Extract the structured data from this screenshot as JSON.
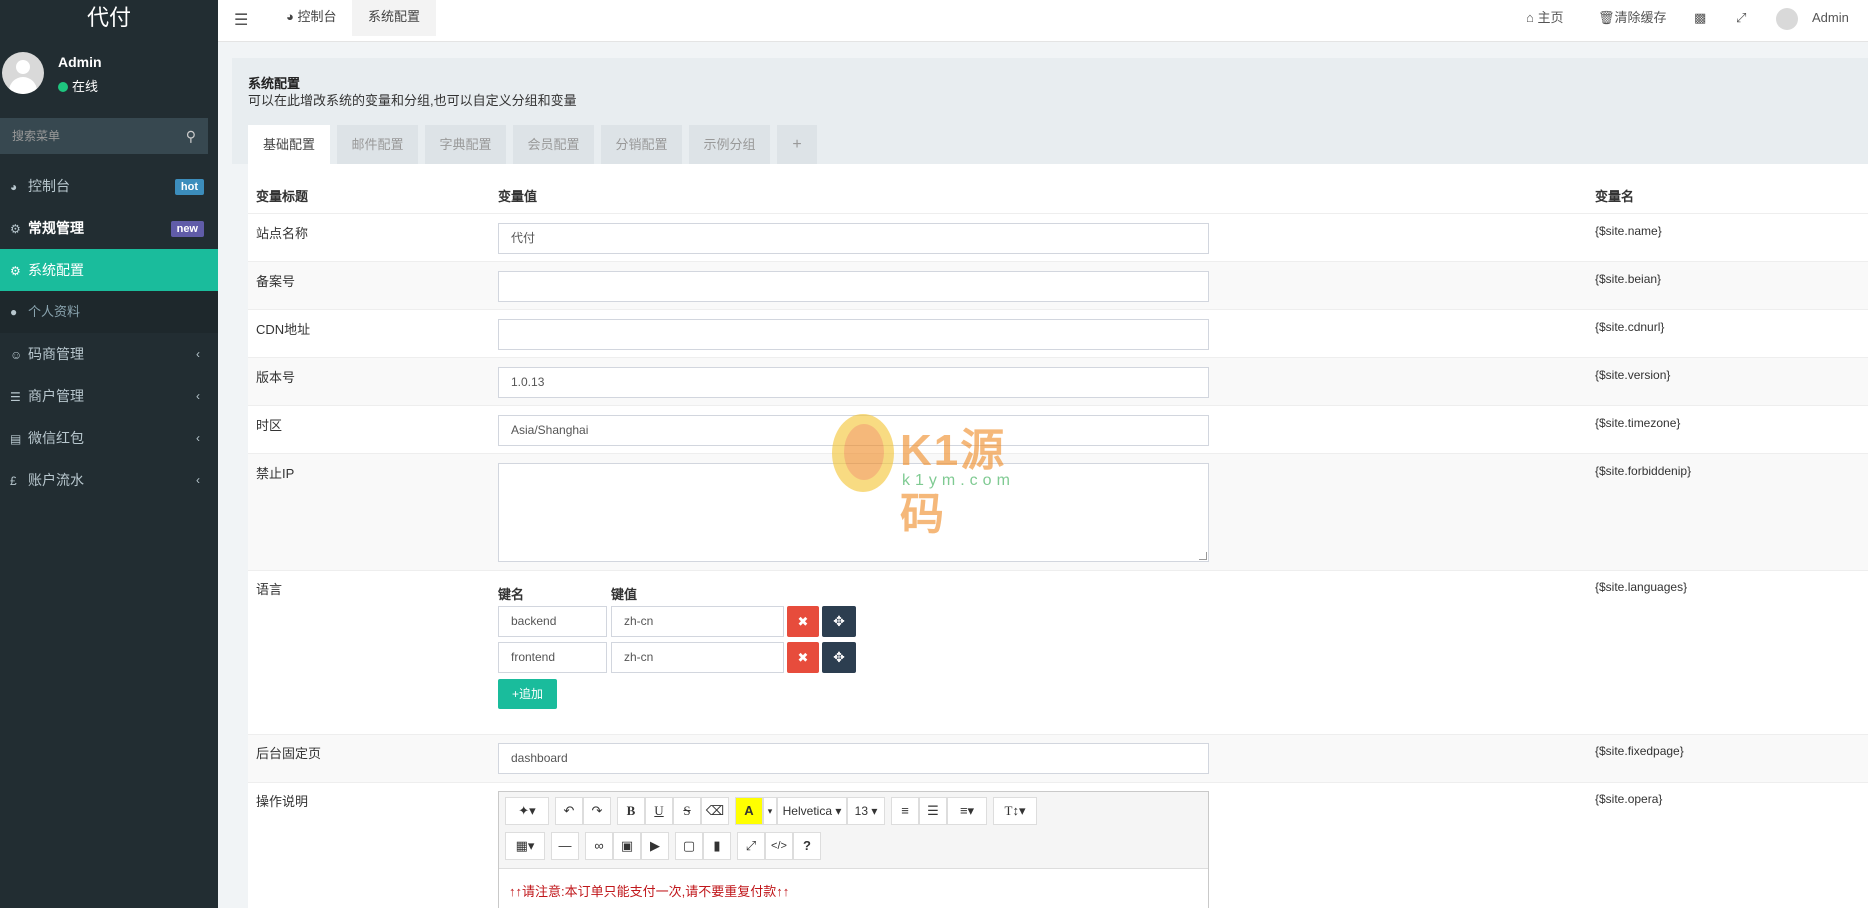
{
  "sidebar": {
    "brand": "代付",
    "user_name": "Admin",
    "user_status": "在线",
    "search_placeholder": "搜索菜单",
    "items": [
      {
        "label": "控制台",
        "icon": "dashboard-icon",
        "badge": "hot"
      },
      {
        "label": "常规管理",
        "icon": "cogs-icon",
        "badge": "new"
      },
      {
        "label": "系统配置",
        "icon": "cog-icon",
        "active": true
      },
      {
        "label": "个人资料",
        "icon": "user-icon",
        "sub": true
      },
      {
        "label": "码商管理",
        "icon": "users-icon"
      },
      {
        "label": "商户管理",
        "icon": "list-icon"
      },
      {
        "label": "微信红包",
        "icon": "database-icon"
      },
      {
        "label": "账户流水",
        "icon": "pound-icon"
      }
    ]
  },
  "topbar": {
    "tab_dashboard": "控制台",
    "tab_config": "系统配置",
    "home": "主页",
    "clear_cache": "清除缓存",
    "admin": "Admin"
  },
  "page": {
    "title": "系统配置",
    "description": "可以在此增改系统的变量和分组,也可以自定义分组和变量",
    "tabs": [
      "基础配置",
      "邮件配置",
      "字典配置",
      "会员配置",
      "分销配置",
      "示例分组",
      "+"
    ]
  },
  "table": {
    "headers": {
      "title": "变量标题",
      "value": "变量值",
      "name": "变量名"
    },
    "rows": [
      {
        "label": "站点名称",
        "value": "代付",
        "var": "{$site.name}"
      },
      {
        "label": "备案号",
        "value": "",
        "var": "{$site.beian}"
      },
      {
        "label": "CDN地址",
        "value": "",
        "var": "{$site.cdnurl}"
      },
      {
        "label": "版本号",
        "value": "1.0.13",
        "var": "{$site.version}"
      },
      {
        "label": "时区",
        "value": "Asia/Shanghai",
        "var": "{$site.timezone}"
      },
      {
        "label": "禁止IP",
        "value": "",
        "var": "{$site.forbiddenip}"
      },
      {
        "label": "语言",
        "var": "{$site.languages}"
      },
      {
        "label": "后台固定页",
        "value": "dashboard",
        "var": "{$site.fixedpage}"
      },
      {
        "label": "操作说明",
        "var": "{$site.opera}"
      }
    ],
    "languages": {
      "key_header": "键名",
      "value_header": "键值",
      "pairs": [
        {
          "key": "backend",
          "value": "zh-cn"
        },
        {
          "key": "frontend",
          "value": "zh-cn"
        }
      ],
      "add_label": "追加"
    }
  },
  "editor": {
    "font": "Helvetica",
    "size": "13",
    "content": "↑↑请注意:本订单只能支付一次,请不要重复付款↑↑"
  },
  "watermark": {
    "text": "K1源码",
    "url": "k1ym.com"
  },
  "colors": {
    "sidebar_bg": "#222d32",
    "accent": "#1abc9c",
    "danger": "#e74c3c",
    "dark": "#2c3e50"
  }
}
